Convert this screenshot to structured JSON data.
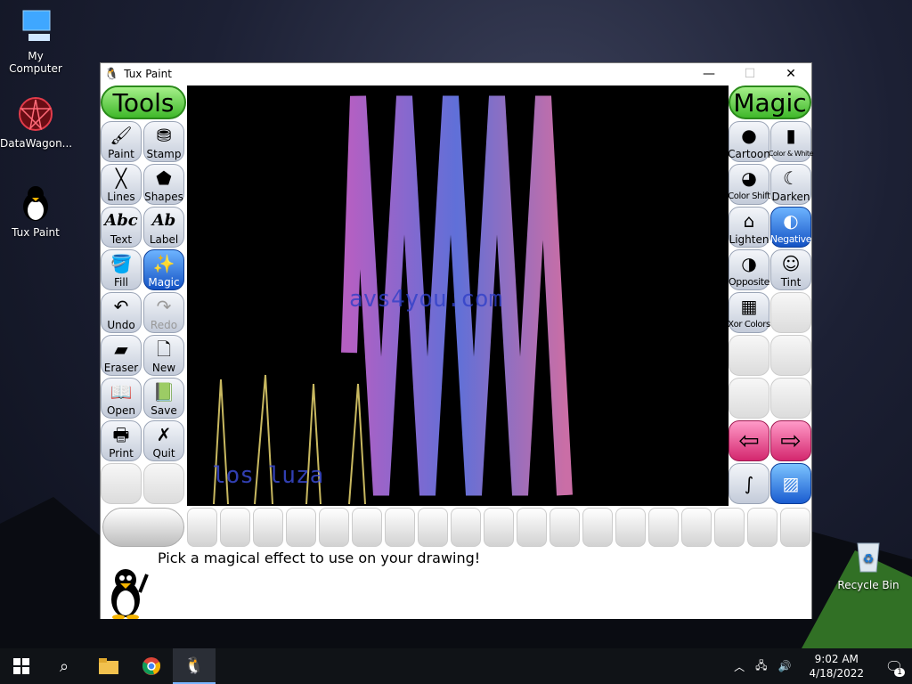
{
  "desktop": {
    "icons": [
      {
        "label": "My Computer"
      },
      {
        "label": "DataWagon..."
      },
      {
        "label": "Tux Paint"
      },
      {
        "label": "Recycle Bin"
      }
    ]
  },
  "window": {
    "title": "Tux Paint",
    "controls": {
      "minimize": "—",
      "maximize": "☐",
      "close": "✕"
    }
  },
  "tools": {
    "header": "Tools",
    "items": [
      {
        "label": "Paint"
      },
      {
        "label": "Stamp"
      },
      {
        "label": "Lines"
      },
      {
        "label": "Shapes"
      },
      {
        "label": "Text"
      },
      {
        "label": "Label"
      },
      {
        "label": "Fill"
      },
      {
        "label": "Magic"
      },
      {
        "label": "Undo"
      },
      {
        "label": "Redo"
      },
      {
        "label": "Eraser"
      },
      {
        "label": "New"
      },
      {
        "label": "Open"
      },
      {
        "label": "Save"
      },
      {
        "label": "Print"
      },
      {
        "label": "Quit"
      }
    ],
    "text_icon": "Abc",
    "label_icon": "Ab"
  },
  "magic": {
    "header": "Magic",
    "items": [
      {
        "label": "Cartoon"
      },
      {
        "label": "Color & White"
      },
      {
        "label": "Color Shift"
      },
      {
        "label": "Darken"
      },
      {
        "label": "Lighten"
      },
      {
        "label": "Negative"
      },
      {
        "label": "Opposite"
      },
      {
        "label": "Tint"
      },
      {
        "label": "Xor Colors"
      }
    ]
  },
  "canvas": {
    "watermark": "avs4you.com",
    "scribble_text": "los luza"
  },
  "status": {
    "message": "Pick a magical effect to use on your drawing!"
  },
  "taskbar": {
    "time": "9:02 AM",
    "date": "4/18/2022",
    "notification_count": "1"
  }
}
